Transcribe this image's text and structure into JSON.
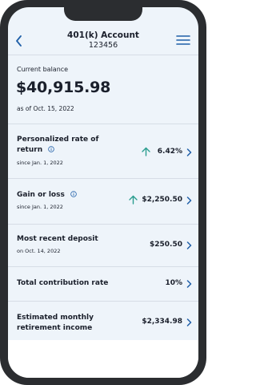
{
  "header": {
    "title": "401(k) Account",
    "account_number": "123456"
  },
  "balance": {
    "label": "Current balance",
    "value": "$40,915.98",
    "as_of": "as of Oct. 15, 2022"
  },
  "rows": [
    {
      "title_line1": "Personalized rate of",
      "title_line2": "return",
      "sub": "since Jan. 1, 2022",
      "value": "6.42%"
    },
    {
      "title_line1": "Gain or loss",
      "sub": "since Jan. 1, 2022",
      "value": "$2,250.50"
    },
    {
      "title_line1": "Most recent deposit",
      "sub": "on Oct. 14, 2022",
      "value": "$250.50"
    },
    {
      "title_line1": "Total contribution rate",
      "value": "10%"
    },
    {
      "title_line1": "Estimated monthly",
      "title_line2": "retirement income",
      "value": "$2,334.98"
    }
  ],
  "colors": {
    "accent": "#1f5fa8",
    "up_arrow": "#2a9d8f",
    "text": "#1a1f2b",
    "screen_bg": "#eef4fa"
  },
  "icons": [
    "back-chevron-icon",
    "hamburger-menu-icon",
    "info-icon",
    "arrow-up-icon",
    "chevron-right-icon"
  ]
}
